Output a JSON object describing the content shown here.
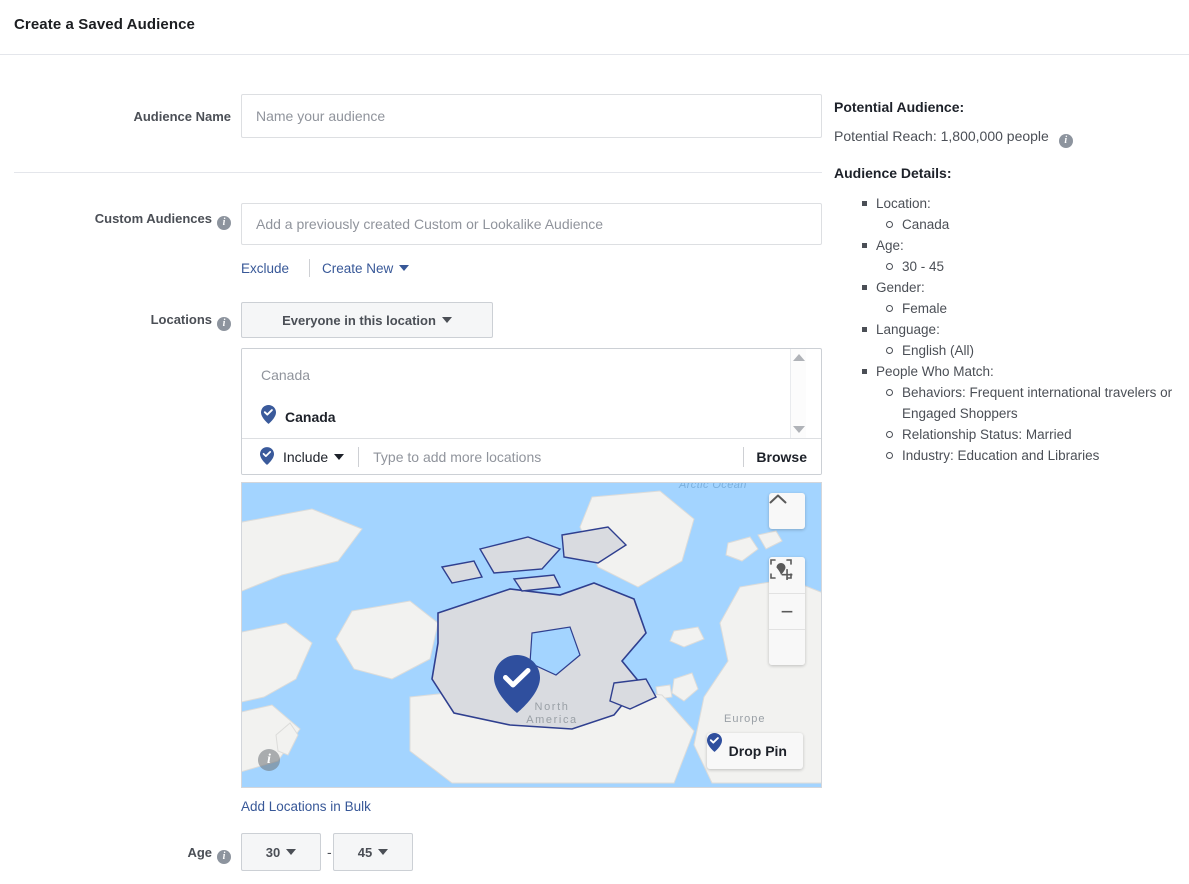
{
  "header": {
    "title": "Create a Saved Audience"
  },
  "form": {
    "audience_name": {
      "label": "Audience Name",
      "placeholder": "Name your audience",
      "value": ""
    },
    "custom_audiences": {
      "label": "Custom Audiences",
      "info_icon": "info-icon",
      "placeholder": "Add a previously created Custom or Lookalike Audience",
      "value": "",
      "exclude_link": "Exclude",
      "create_new_link": "Create New"
    },
    "locations": {
      "label": "Locations",
      "info_icon": "info-icon",
      "scope_button": "Everyone in this location",
      "group_heading": "Canada",
      "selected": [
        {
          "name": "Canada",
          "icon": "location-pin-check-icon"
        }
      ],
      "include_selector": "Include",
      "add_placeholder": "Type to add more locations",
      "browse_button": "Browse",
      "bulk_link": "Add Locations in Bulk"
    },
    "map": {
      "arctic_label": "Arctic Ocean",
      "north_america_label": "North\nAmerica",
      "europe_label": "Europe",
      "drop_pin_button": "Drop Pin",
      "collapse_icon": "chevron-up-icon",
      "zoom_in": "+",
      "zoom_out": "−",
      "locate_icon": "locate-pin-icon",
      "info_icon": "info-icon",
      "ocean_color": "#a3d4ff",
      "land_color": "#f2f2f0",
      "highlight_color": "#d9dbe0",
      "pin_color": "#2f4f9e"
    },
    "age": {
      "label": "Age",
      "info_icon": "info-icon",
      "min": "30",
      "max": "45",
      "separator": "-"
    }
  },
  "sidebar": {
    "potential_audience_heading": "Potential Audience:",
    "potential_reach": "Potential Reach: 1,800,000 people",
    "reach_info_icon": "info-icon",
    "audience_details_heading": "Audience Details:",
    "details": [
      {
        "label": "Location:",
        "values": [
          "Canada"
        ]
      },
      {
        "label": "Age:",
        "values": [
          "30 - 45"
        ]
      },
      {
        "label": "Gender:",
        "values": [
          "Female"
        ]
      },
      {
        "label": "Language:",
        "values": [
          "English (All)"
        ]
      },
      {
        "label": "People Who Match:",
        "values": [
          "Behaviors: Frequent international travelers or Engaged Shoppers",
          "Relationship Status: Married",
          "Industry: Education and Libraries"
        ]
      }
    ]
  },
  "colors": {
    "link": "#385898",
    "text_primary": "#1d2129",
    "text_secondary": "#4b4f56",
    "placeholder": "#90949c",
    "border": "#ccd0d5"
  }
}
